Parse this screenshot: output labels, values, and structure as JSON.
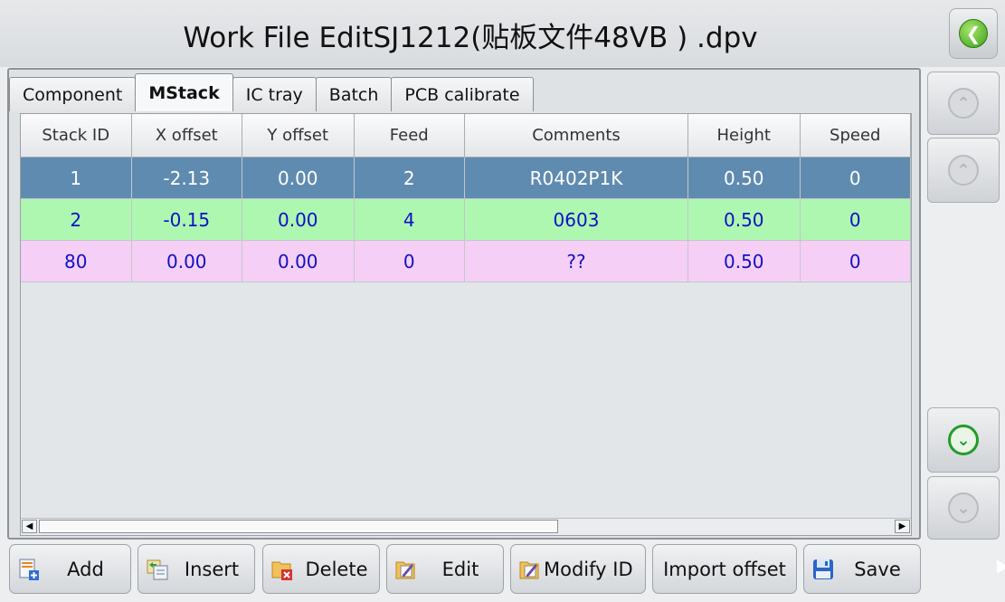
{
  "window": {
    "title": "Work File EditSJ1212(贴板文件48VB ) .dpv"
  },
  "tabs": [
    {
      "label": "Component",
      "active": false
    },
    {
      "label": "MStack",
      "active": true
    },
    {
      "label": "IC tray",
      "active": false
    },
    {
      "label": "Batch",
      "active": false
    },
    {
      "label": "PCB calibrate",
      "active": false
    }
  ],
  "table": {
    "headers": [
      "Stack ID",
      "X offset",
      "Y offset",
      "Feed",
      "Comments",
      "Height",
      "Speed"
    ],
    "rows": [
      [
        "1",
        "-2.13",
        "0.00",
        "2",
        "R0402P1K",
        "0.50",
        "0"
      ],
      [
        "2",
        "-0.15",
        "0.00",
        "4",
        "0603",
        "0.50",
        "0"
      ],
      [
        "80",
        "0.00",
        "0.00",
        "0",
        "??",
        "0.50",
        "0"
      ]
    ],
    "selected_row_index": 0
  },
  "nav": {
    "first_icon": "double-chevron-up-icon",
    "prev_icon": "chevron-up-icon",
    "next_icon": "chevron-down-icon",
    "last_icon": "double-chevron-down-icon"
  },
  "toolbar": {
    "add_label": "Add",
    "insert_label": "Insert",
    "delete_label": "Delete",
    "edit_label": "Edit",
    "modify_id_label": "Modify ID",
    "import_offset_label": "Import offset",
    "save_label": "Save"
  },
  "colors": {
    "selected_row": "#5f8bb0",
    "row_green": "#adf7b0",
    "row_pink": "#f6cff6",
    "value_text": "#1010c8",
    "accent_green": "#239b2b"
  }
}
